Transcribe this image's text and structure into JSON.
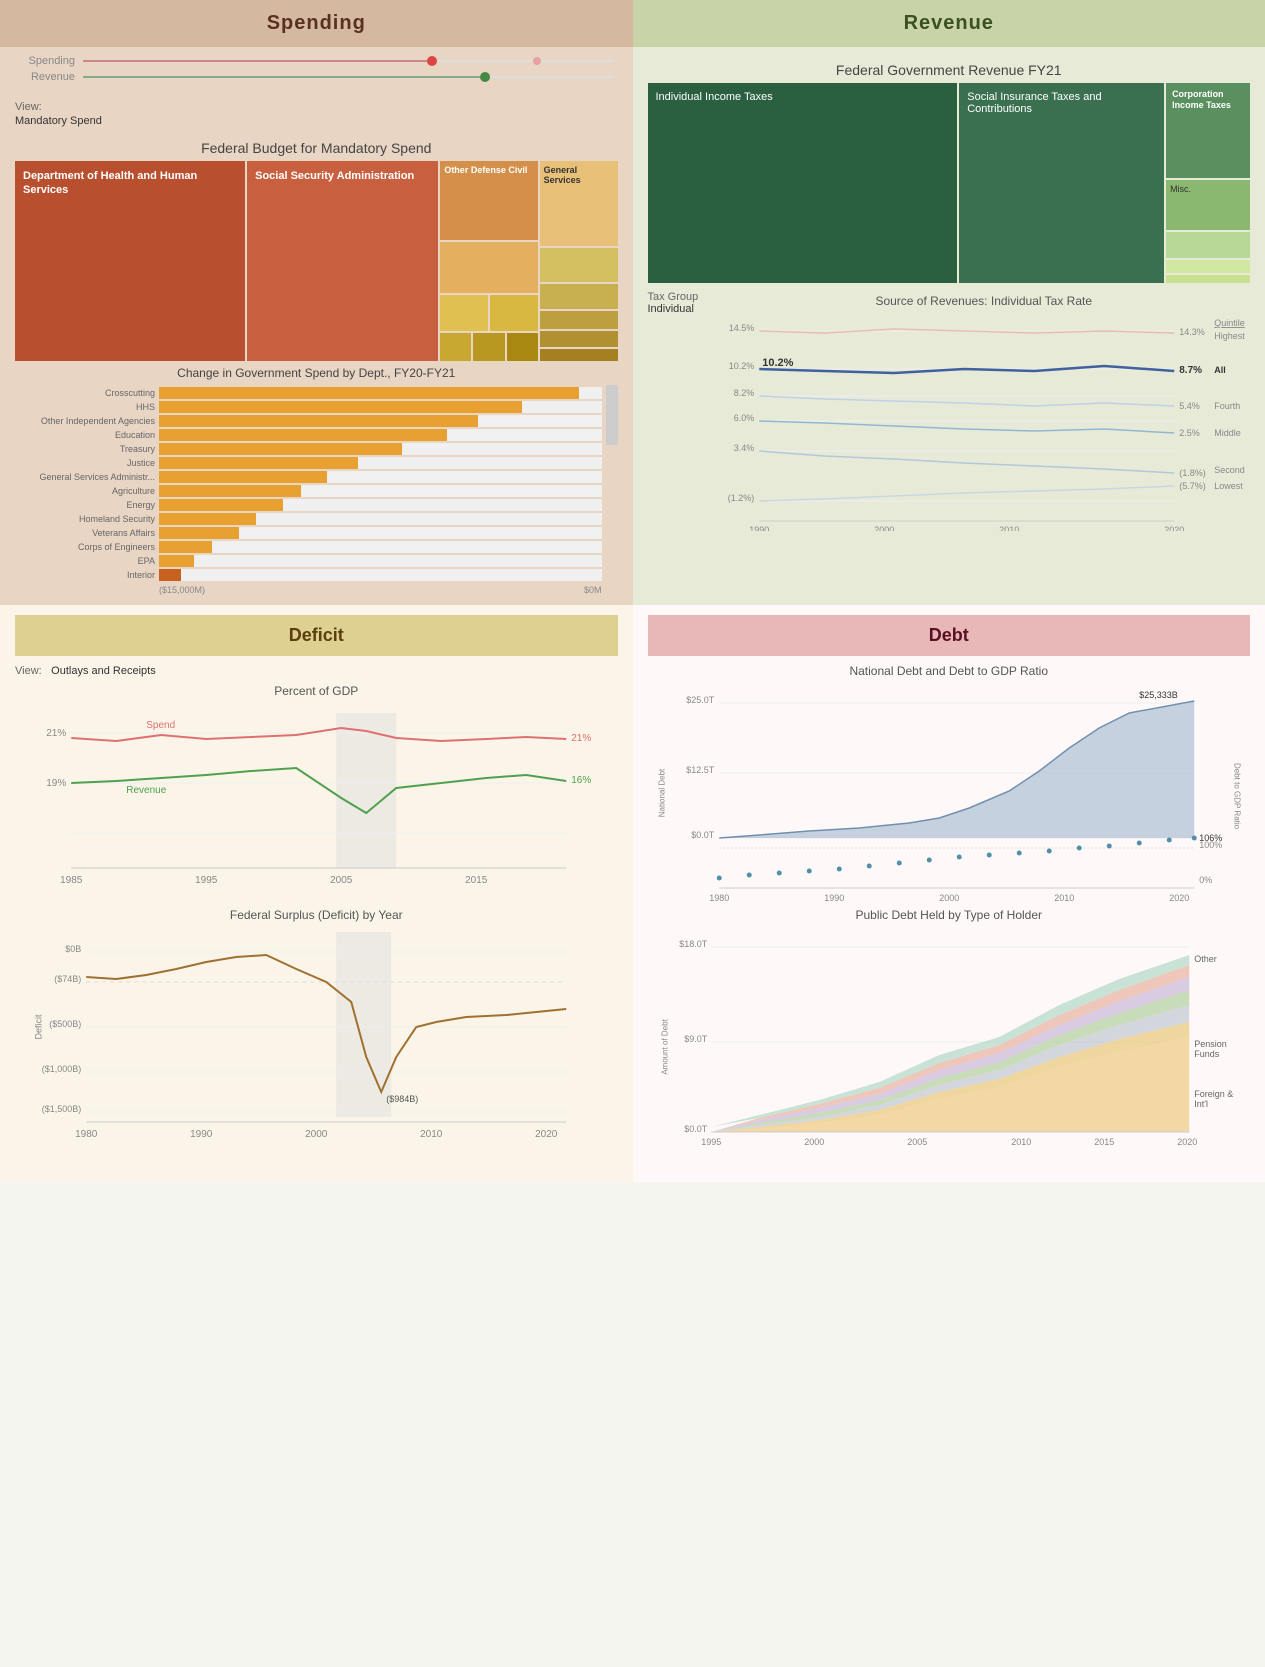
{
  "spending": {
    "header": "Spending",
    "view_label": "View:",
    "view_value": "Mandatory Spend",
    "chart_title": "Federal Budget for Mandatory Spend",
    "treemap": {
      "hhs": "Department of Health and Human Services",
      "ssa": "Social Security Administration",
      "other_defense": "Other Defense Civil",
      "general": "General Services"
    },
    "bar_chart_title": "Change in Government Spend by Dept., FY20-FY21",
    "bar_items": [
      {
        "label": "Crosscutting",
        "pct": 95
      },
      {
        "label": "HHS",
        "pct": 82
      },
      {
        "label": "Other Independent Agencies",
        "pct": 72
      },
      {
        "label": "Education",
        "pct": 65
      },
      {
        "label": "Treasury",
        "pct": 55
      },
      {
        "label": "Justice",
        "pct": 45
      },
      {
        "label": "General Services Administr...",
        "pct": 38
      },
      {
        "label": "Agriculture",
        "pct": 32
      },
      {
        "label": "Energy",
        "pct": 28
      },
      {
        "label": "Homeland Security",
        "pct": 22
      },
      {
        "label": "Veterans Affairs",
        "pct": 18
      },
      {
        "label": "Corps of Engineers",
        "pct": 12
      },
      {
        "label": "EPA",
        "pct": 8
      },
      {
        "label": "Interior",
        "pct": 5
      }
    ],
    "bar_x_labels": [
      "($15,000M)",
      "$0M"
    ],
    "timeline_spending": "Spending",
    "timeline_revenue": "Revenue"
  },
  "revenue": {
    "header": "Revenue",
    "chart_title": "Federal Government Revenue FY21",
    "treemap": {
      "individual": "Individual Income Taxes",
      "social": "Social Insurance Taxes and Contributions",
      "corp": "Corporation Income Taxes",
      "misc": "Misc.",
      "small1": "",
      "small2": ""
    },
    "tax_group_label": "Tax Group",
    "tax_group_value": "Individual",
    "line_chart_title": "Source of Revenues: Individual Tax Rate",
    "quintile_label": "Quintile",
    "quintile_items": [
      "Highest",
      "All",
      "Fourth",
      "Middle",
      "Second",
      "Lowest"
    ],
    "y_axis_labels": [
      "14.5%",
      "10.2%",
      "8.2%",
      "6.0%",
      "3.4%",
      "(1.2%)"
    ],
    "y_axis_right": [
      "14.3%",
      "8.7%",
      "5.4%",
      "2.5%",
      "(1.8%)",
      "(5.7%)"
    ],
    "x_axis_labels": [
      "1990",
      "2000",
      "2010",
      "2020"
    ]
  },
  "deficit": {
    "header": "Deficit",
    "view_label": "View:",
    "view_value": "Outlays and Receipts",
    "chart_title": "Percent of GDP",
    "spend_label": "Spend",
    "revenue_label": "Revenue",
    "spend_right": "21%",
    "revenue_right": "16%",
    "spend_left": "21%",
    "revenue_left": "19%",
    "x_axis": [
      "1985",
      "1995",
      "2005",
      "2015"
    ],
    "surplus_title": "Federal Surplus (Deficit) by Year",
    "surplus_y": [
      "$0B",
      "($74B)",
      "($500B)",
      "($1,000B)",
      "($1,500B)"
    ],
    "surplus_annotations": [
      "($984B)"
    ],
    "surplus_x": [
      "1980",
      "1990",
      "2000",
      "2010",
      "2020"
    ]
  },
  "debt": {
    "header": "Debt",
    "nat_debt_title": "National Debt and Debt to GDP Ratio",
    "nat_debt_y": [
      "$25.0T",
      "$12.5T",
      "$0.0T"
    ],
    "nat_debt_ratio_y": [
      "100%",
      "0%"
    ],
    "nat_debt_annotation": "$25,333B",
    "nat_debt_ratio_annotation": "106%",
    "nat_debt_x": [
      "1980",
      "1990",
      "2000",
      "2010",
      "2020"
    ],
    "y_label_debt": "National Debt",
    "y_label_ratio": "Debt to GDP Ratio",
    "holder_title": "Public Debt Held by Type of Holder",
    "holder_y": [
      "$18.0T",
      "$9.0T",
      "$0.0T"
    ],
    "holder_x": [
      "1995",
      "2000",
      "2005",
      "2010",
      "2015",
      "2020"
    ],
    "holder_legend": [
      "Other",
      "Pension Funds",
      "Foreign & Int'l"
    ],
    "amount_of_debt_label": "Amount of Debt"
  }
}
